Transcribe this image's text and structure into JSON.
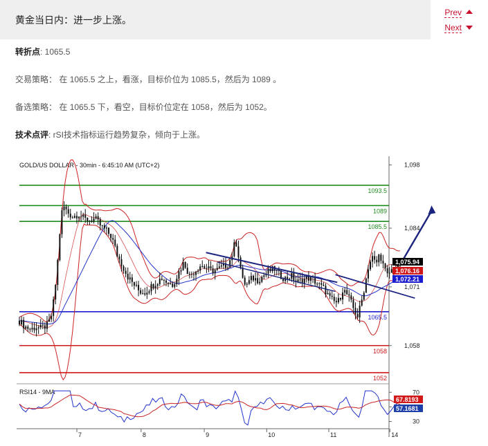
{
  "header": {
    "title": "黄金当日内：进一步上涨。",
    "prev_label": "Prev",
    "next_label": "Next"
  },
  "content": {
    "pivot_label": "转折点",
    "pivot_value": ": 1065.5",
    "strategy_label": "交易策略：",
    "strategy_text": "在 1065.5 之上，看涨，目标价位为 1085.5，然后为 1089 。",
    "alt_label": "备选策略：",
    "alt_text": "在 1065.5 下，看空，目标价位定在 1058，然后为 1052。",
    "comment_label": "技术点评",
    "comment_text": ": rSI技术指标运行趋势复杂，倾向于上涨。"
  },
  "colors": {
    "resistance": "#1e8c1e",
    "pivot": "#1c1ccf",
    "support": "#d01818",
    "bollinger": "#cc2222",
    "moving_average": "#2233cc",
    "candles": "#111111",
    "arrow": "#1a237e"
  },
  "chart_data": {
    "type": "candlestick",
    "title": "GOLD/US DOLLAR - 30min - 6:45:10 AM (UTC+2)",
    "ylim": [
      1050,
      1099
    ],
    "y_ticks": [
      1058,
      1071,
      1084,
      1098
    ],
    "y_tick_labels": [
      "1,058",
      "1,071",
      "1,084",
      "1,098"
    ],
    "x_tick_labels": [
      "7",
      "8",
      "9",
      "10",
      "11",
      "14"
    ],
    "x_tick_positions": [
      0.162,
      0.343,
      0.521,
      0.697,
      0.872,
      1.044
    ],
    "levels": [
      {
        "value": 1093.5,
        "label": "1093.5",
        "type": "resistance"
      },
      {
        "value": 1089,
        "label": "1089",
        "type": "resistance"
      },
      {
        "value": 1085.5,
        "label": "1085.5",
        "type": "resistance"
      },
      {
        "value": 1065.5,
        "label": "1065.5",
        "type": "pivot"
      },
      {
        "value": 1058,
        "label": "1058",
        "type": "support"
      },
      {
        "value": 1052,
        "label": "1052",
        "type": "support"
      }
    ],
    "price_tags": [
      {
        "label": "1,075.94",
        "value": 1075.94,
        "type": "close"
      },
      {
        "label": "1,076.16",
        "value": 1073.6,
        "type": "bollinger"
      },
      {
        "label": "1,072.21",
        "value": 1072.21,
        "type": "moving_average"
      }
    ],
    "close_path": [
      [
        0.0,
        1063.5
      ],
      [
        0.015,
        1062.2
      ],
      [
        0.03,
        1061.6
      ],
      [
        0.045,
        1062.1
      ],
      [
        0.06,
        1061.8
      ],
      [
        0.075,
        1062.5
      ],
      [
        0.085,
        1064.0
      ],
      [
        0.095,
        1069.0
      ],
      [
        0.105,
        1078.0
      ],
      [
        0.112,
        1086.0
      ],
      [
        0.118,
        1089.0
      ],
      [
        0.13,
        1087.5
      ],
      [
        0.145,
        1086.5
      ],
      [
        0.16,
        1087.2
      ],
      [
        0.175,
        1086.0
      ],
      [
        0.19,
        1085.8
      ],
      [
        0.205,
        1086.1
      ],
      [
        0.22,
        1084.5
      ],
      [
        0.235,
        1083.5
      ],
      [
        0.25,
        1082.0
      ],
      [
        0.265,
        1078.0
      ],
      [
        0.28,
        1075.5
      ],
      [
        0.295,
        1073.0
      ],
      [
        0.31,
        1071.5
      ],
      [
        0.325,
        1070.0
      ],
      [
        0.34,
        1069.8
      ],
      [
        0.355,
        1071.0
      ],
      [
        0.37,
        1072.0
      ],
      [
        0.385,
        1073.0
      ],
      [
        0.4,
        1072.0
      ],
      [
        0.415,
        1071.5
      ],
      [
        0.43,
        1074.0
      ],
      [
        0.445,
        1076.5
      ],
      [
        0.46,
        1073.5
      ],
      [
        0.475,
        1074.5
      ],
      [
        0.49,
        1075.8
      ],
      [
        0.505,
        1075.2
      ],
      [
        0.52,
        1074.5
      ],
      [
        0.535,
        1074.8
      ],
      [
        0.55,
        1075.5
      ],
      [
        0.565,
        1076.0
      ],
      [
        0.575,
        1078.0
      ],
      [
        0.585,
        1081.5
      ],
      [
        0.595,
        1077.0
      ],
      [
        0.605,
        1072.0
      ],
      [
        0.615,
        1071.5
      ],
      [
        0.63,
        1073.0
      ],
      [
        0.645,
        1072.5
      ],
      [
        0.66,
        1073.5
      ],
      [
        0.675,
        1074.5
      ],
      [
        0.69,
        1075.0
      ],
      [
        0.705,
        1073.5
      ],
      [
        0.72,
        1072.8
      ],
      [
        0.735,
        1073.5
      ],
      [
        0.75,
        1072.0
      ],
      [
        0.765,
        1072.5
      ],
      [
        0.78,
        1073.0
      ],
      [
        0.795,
        1072.5
      ],
      [
        0.81,
        1071.5
      ],
      [
        0.825,
        1070.5
      ],
      [
        0.84,
        1068.5
      ],
      [
        0.855,
        1067.5
      ],
      [
        0.865,
        1068.0
      ],
      [
        0.875,
        1070.5
      ],
      [
        0.885,
        1069.5
      ],
      [
        0.895,
        1068.0
      ],
      [
        0.905,
        1066.0
      ],
      [
        0.915,
        1064.5
      ],
      [
        0.925,
        1067.5
      ],
      [
        0.935,
        1071.5
      ],
      [
        0.945,
        1076.0
      ],
      [
        0.955,
        1077.5
      ],
      [
        0.965,
        1076.0
      ],
      [
        0.975,
        1078.5
      ],
      [
        0.985,
        1075.5
      ],
      [
        0.995,
        1073.5
      ],
      [
        1.005,
        1074.5
      ],
      [
        1.015,
        1075.5
      ],
      [
        1.03,
        1075.9
      ]
    ],
    "rsi": {
      "label": "RSI14 - 9MA",
      "ylim": [
        22,
        75
      ],
      "ticks": [
        30,
        50,
        70
      ],
      "tags": [
        {
          "label": "67.8193",
          "value": 67.8193,
          "type": "rsi"
        },
        {
          "label": "57.1681",
          "value": 57.1681,
          "type": "ma"
        }
      ]
    }
  }
}
